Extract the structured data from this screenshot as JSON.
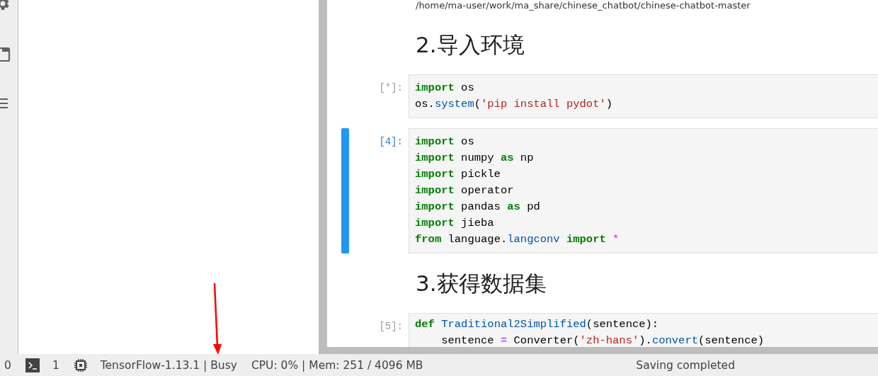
{
  "activity_bar": {
    "items": [
      {
        "kind": "gear"
      },
      {
        "kind": "tabs"
      },
      {
        "kind": "list"
      }
    ]
  },
  "notebook": {
    "cells": [
      {
        "kind": "output",
        "text": "/home/ma-user/work/ma_share/chinese_chatbot/chinese-chatbot-master"
      },
      {
        "kind": "heading",
        "text": "2.导入环境"
      },
      {
        "kind": "code",
        "prompt": "[*]:",
        "selected": false,
        "lines": [
          [
            {
              "t": "import",
              "kind": "kw"
            },
            {
              "t": " os",
              "kind": "name"
            }
          ],
          [
            {
              "t": "os.",
              "kind": "name"
            },
            {
              "t": "system",
              "kind": "attr"
            },
            {
              "t": "(",
              "kind": "name"
            },
            {
              "t": "'pip install pydot'",
              "kind": "str"
            },
            {
              "t": ")",
              "kind": "name"
            }
          ]
        ]
      },
      {
        "kind": "code",
        "prompt": "[4]:",
        "selected": true,
        "lines": [
          [
            {
              "t": "import",
              "kind": "kw"
            },
            {
              "t": " os",
              "kind": "name"
            }
          ],
          [
            {
              "t": "import",
              "kind": "kw"
            },
            {
              "t": " numpy ",
              "kind": "name"
            },
            {
              "t": "as",
              "kind": "kw"
            },
            {
              "t": " np",
              "kind": "name"
            }
          ],
          [
            {
              "t": "import",
              "kind": "kw"
            },
            {
              "t": " pickle",
              "kind": "name"
            }
          ],
          [
            {
              "t": "import",
              "kind": "kw"
            },
            {
              "t": " operator",
              "kind": "name"
            }
          ],
          [
            {
              "t": "import",
              "kind": "kw"
            },
            {
              "t": " pandas ",
              "kind": "name"
            },
            {
              "t": "as",
              "kind": "kw"
            },
            {
              "t": " pd",
              "kind": "name"
            }
          ],
          [
            {
              "t": "import",
              "kind": "kw"
            },
            {
              "t": " jieba",
              "kind": "name"
            }
          ],
          [
            {
              "t": "from",
              "kind": "kw"
            },
            {
              "t": " language.",
              "kind": "name"
            },
            {
              "t": "langconv ",
              "kind": "attr"
            },
            {
              "t": "import ",
              "kind": "kw"
            },
            {
              "t": "*",
              "kind": "op"
            }
          ]
        ]
      },
      {
        "kind": "heading",
        "text": "3.获得数据集"
      },
      {
        "kind": "code",
        "prompt": "[5]:",
        "selected": false,
        "lines": [
          [
            {
              "t": "def ",
              "kind": "kw"
            },
            {
              "t": "Traditional2Simplified",
              "kind": "attr"
            },
            {
              "t": "(sentence):",
              "kind": "name"
            }
          ],
          [
            {
              "t": "    sentence ",
              "kind": "name"
            },
            {
              "t": "=",
              "kind": "op"
            },
            {
              "t": " Converter(",
              "kind": "name"
            },
            {
              "t": "'zh-hans'",
              "kind": "str"
            },
            {
              "t": ").",
              "kind": "name"
            },
            {
              "t": "convert",
              "kind": "attr"
            },
            {
              "t": "(sentence)",
              "kind": "name"
            }
          ]
        ]
      }
    ]
  },
  "status_bar": {
    "items": [
      {
        "kind": "text",
        "text": "0"
      },
      {
        "kind": "terminal"
      },
      {
        "kind": "text",
        "text": "1"
      },
      {
        "kind": "chip"
      },
      {
        "kind": "text",
        "text": "TensorFlow-1.13.1 | Busy"
      },
      {
        "kind": "text",
        "text": "CPU: 0% | Mem: 251 / 4096 MB"
      }
    ],
    "message": "Saving completed"
  },
  "annotation": {
    "kind": "arrow"
  }
}
